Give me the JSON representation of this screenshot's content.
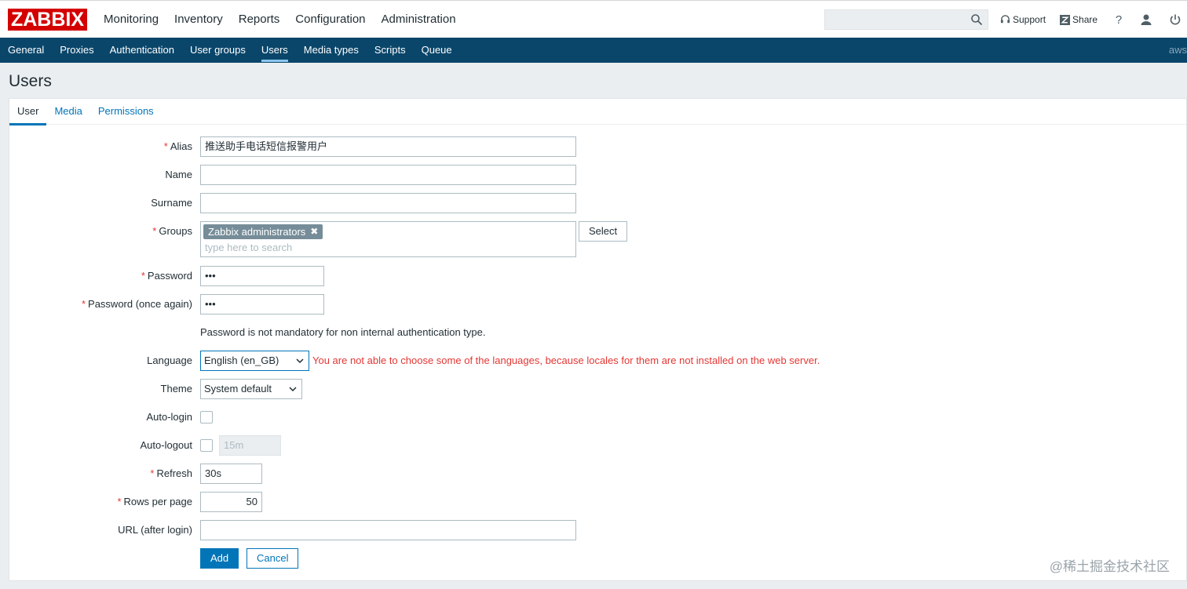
{
  "brand": {
    "logo": "ZABBIX"
  },
  "topnav": [
    "Monitoring",
    "Inventory",
    "Reports",
    "Configuration",
    "Administration"
  ],
  "tools": {
    "support": "Support",
    "share": "Share",
    "help": "?"
  },
  "subnav": [
    "General",
    "Proxies",
    "Authentication",
    "User groups",
    "Users",
    "Media types",
    "Scripts",
    "Queue"
  ],
  "server_label": "aws",
  "page_title": "Users",
  "tabs": [
    "User",
    "Media",
    "Permissions"
  ],
  "form": {
    "alias_label": "Alias",
    "alias_value": "推送助手电话短信报警用户",
    "name_label": "Name",
    "surname_label": "Surname",
    "groups_label": "Groups",
    "group_chip": "Zabbix administrators",
    "groups_placeholder": "type here to search",
    "select_button": "Select",
    "password_label": "Password",
    "password_value": "•••",
    "password2_label": "Password (once again)",
    "password2_value": "•••",
    "password_hint": "Password is not mandatory for non internal authentication type.",
    "language_label": "Language",
    "language_value": "English (en_GB)",
    "language_error": "You are not able to choose some of the languages, because locales for them are not installed on the web server.",
    "theme_label": "Theme",
    "theme_value": "System default",
    "autologin_label": "Auto-login",
    "autologout_label": "Auto-logout",
    "autologout_value": "15m",
    "refresh_label": "Refresh",
    "refresh_value": "30s",
    "rows_label": "Rows per page",
    "rows_value": "50",
    "url_label": "URL (after login)",
    "add_button": "Add",
    "cancel_button": "Cancel"
  },
  "watermark": "@稀土掘金技术社区",
  "colors": {
    "brand_red": "#d40000",
    "subnav_bg": "#0a466a",
    "link_blue": "#0275b8",
    "error_red": "#e33734"
  }
}
